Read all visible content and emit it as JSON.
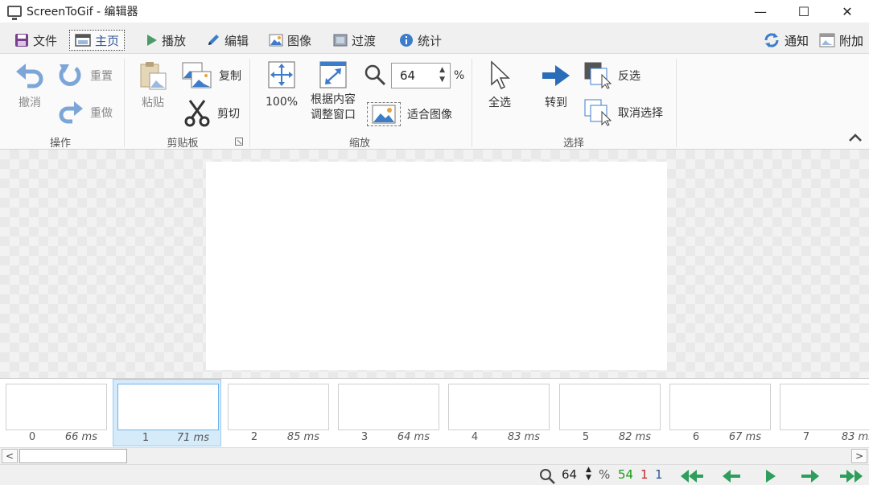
{
  "window": {
    "title": "ScreenToGif - 编辑器",
    "minimize": "—",
    "maximize": "☐",
    "close": "✕"
  },
  "tabs": [
    {
      "label": "文件",
      "icon": "save-icon"
    },
    {
      "label": "主页",
      "icon": "home-icon",
      "active": true
    },
    {
      "label": "播放",
      "icon": "play-icon"
    },
    {
      "label": "编辑",
      "icon": "pencil-icon"
    },
    {
      "label": "图像",
      "icon": "image-icon"
    },
    {
      "label": "过渡",
      "icon": "transition-icon"
    },
    {
      "label": "统计",
      "icon": "info-icon"
    }
  ],
  "header_right": {
    "notify": "通知",
    "attach": "附加"
  },
  "ribbon": {
    "operation": {
      "label": "操作",
      "undo": "撤消",
      "reset": "重置",
      "redo": "重做"
    },
    "clipboard": {
      "label": "剪贴板",
      "paste": "粘贴",
      "copy": "复制",
      "cut": "剪切"
    },
    "zoom": {
      "label": "缩放",
      "hundred": "100%",
      "fit_line1": "根据内容",
      "fit_line2": "调整窗口",
      "zoom_value": "64",
      "percent": "%",
      "fit_image": "适合图像"
    },
    "selection": {
      "label": "选择",
      "select_all": "全选",
      "go_to": "转到",
      "invert": "反选",
      "deselect": "取消选择"
    }
  },
  "frames": [
    {
      "number": "0",
      "duration": "66 ms"
    },
    {
      "number": "1",
      "duration": "71 ms",
      "selected": true
    },
    {
      "number": "2",
      "duration": "85 ms"
    },
    {
      "number": "3",
      "duration": "64 ms"
    },
    {
      "number": "4",
      "duration": "83 ms"
    },
    {
      "number": "5",
      "duration": "82 ms"
    },
    {
      "number": "6",
      "duration": "67 ms"
    },
    {
      "number": "7",
      "duration": "83 ms"
    }
  ],
  "scrollbar": {
    "left": "<",
    "right": ">"
  },
  "status": {
    "zoom_value": "64",
    "percent": "%",
    "frame_count": "54",
    "selected_count": "1",
    "current_frame": "1",
    "colors": {
      "count": "#1a9a1a",
      "selected": "#c0282d",
      "current": "#2b5797",
      "nav": "#2e9e5b"
    }
  },
  "colors": {
    "accent": "#2b5797",
    "icon_blue": "#3d7cc9"
  }
}
